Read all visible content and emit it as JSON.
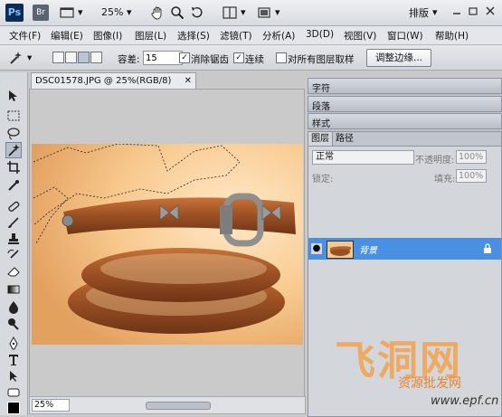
{
  "appbar": {
    "ps_logo": "Ps",
    "br_logo": "Br",
    "zoom": "25%",
    "workspace": "排版",
    "workspace_arrow": "▾",
    "dropdown_arrow": "▾"
  },
  "menu": [
    "文件(F)",
    "编辑(E)",
    "图像(I)",
    "图层(L)",
    "选择(S)",
    "滤镜(T)",
    "分析(A)",
    "3D(D)",
    "视图(V)",
    "窗口(W)",
    "帮助(H)"
  ],
  "options": {
    "tolerance_label": "容差:",
    "tolerance_value": "15",
    "antialias_label": "消除锯齿",
    "contiguous_label": "连续",
    "sample_all_label": "对所有图层取样",
    "refine_edge_label": "调整边缘..."
  },
  "document": {
    "tab_title": "DSC01578.JPG @ 25%(RGB/8)",
    "zoom_status": "25%"
  },
  "panels": {
    "collapsed": [
      "字符",
      "段落",
      "样式"
    ],
    "layer_tabs": [
      "图层",
      "路径"
    ],
    "blend_mode": "正常",
    "opacity_label": "不透明度:",
    "opacity_value": "100%",
    "lock_label": "锁定:",
    "fill_label": "填充:",
    "fill_value": "100%",
    "layer_name": "背景"
  },
  "watermark": {
    "logo_text": "飞洞网",
    "subtitle": "资源批发网",
    "site": "www.epf.cn"
  },
  "colors": {
    "selected_layer": "#4a90e2",
    "watermark_orange": "#f3a34d"
  }
}
